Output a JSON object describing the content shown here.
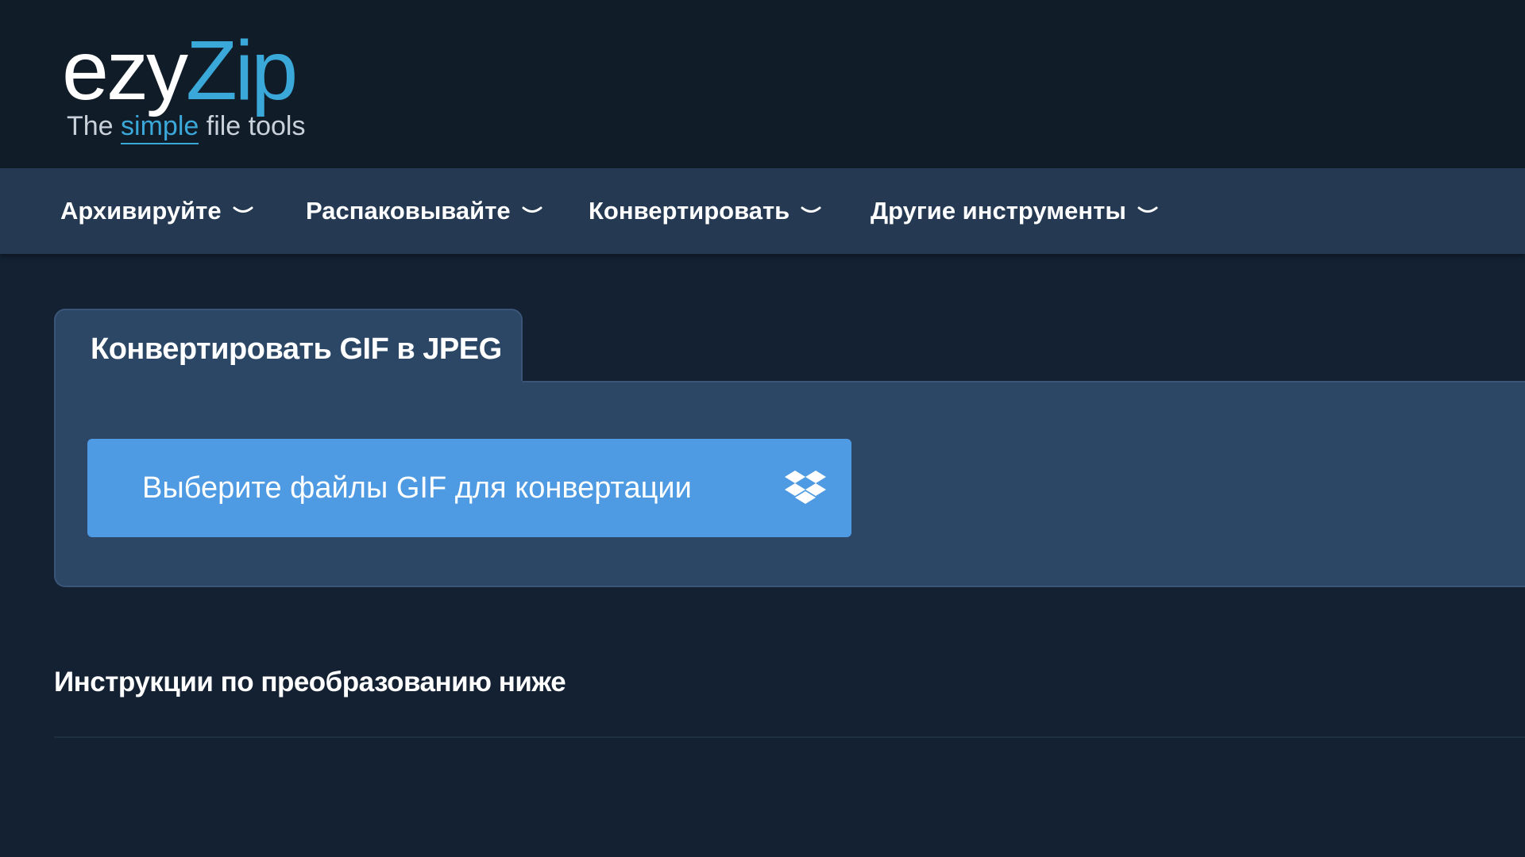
{
  "logo": {
    "ezy": "ezy",
    "zip": "Zip",
    "tagline_pre": "The ",
    "tagline_simple": "simple",
    "tagline_post": " file tools"
  },
  "nav": {
    "items": [
      {
        "label": "Архивируйте",
        "icon": "chevron-down-icon"
      },
      {
        "label": "Распаковывайте",
        "icon": "chevron-down-icon"
      },
      {
        "label": "Конвертировать",
        "icon": "chevron-down-icon"
      },
      {
        "label": "Другие инструменты",
        "icon": "chevron-down-icon"
      }
    ]
  },
  "converter": {
    "title": "Конвертировать GIF в JPEG",
    "upload_label": "Выберите файлы GIF для конвертации",
    "dropbox_icon": "dropbox-icon"
  },
  "instructions": {
    "heading": "Инструкции по преобразованию ниже"
  },
  "colors": {
    "header_bg": "#111c29",
    "nav_bg": "#253a52",
    "page_bg": "#132132",
    "panel_bg": "#2c4766",
    "accent": "#3aa8d8",
    "button": "#4f9be3"
  }
}
